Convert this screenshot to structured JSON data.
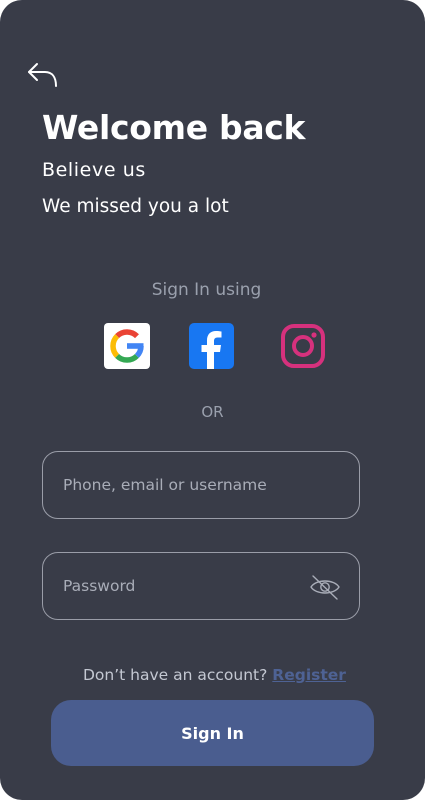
{
  "header": {
    "back_icon": "back-arrow-icon",
    "title": "Welcome back",
    "subtitle_line1": "Believe us",
    "subtitle_line2": "We missed you a lot"
  },
  "social": {
    "label": "Sign In using",
    "providers": [
      "google-icon",
      "facebook-icon",
      "instagram-icon"
    ],
    "colors": {
      "facebook": "#1877f2",
      "instagram": "#d6317d"
    }
  },
  "divider_text": "OR",
  "form": {
    "username_placeholder": "Phone, email or username",
    "username_value": "",
    "password_placeholder": "Password",
    "password_value": "",
    "password_toggle_icon": "eye-off-icon"
  },
  "register": {
    "prompt": "Don’t have an account?",
    "link": "Register"
  },
  "submit_label": "Sign In",
  "theme": {
    "background": "#393c48",
    "accent": "#4a5d8f",
    "link": "#4e6294"
  }
}
